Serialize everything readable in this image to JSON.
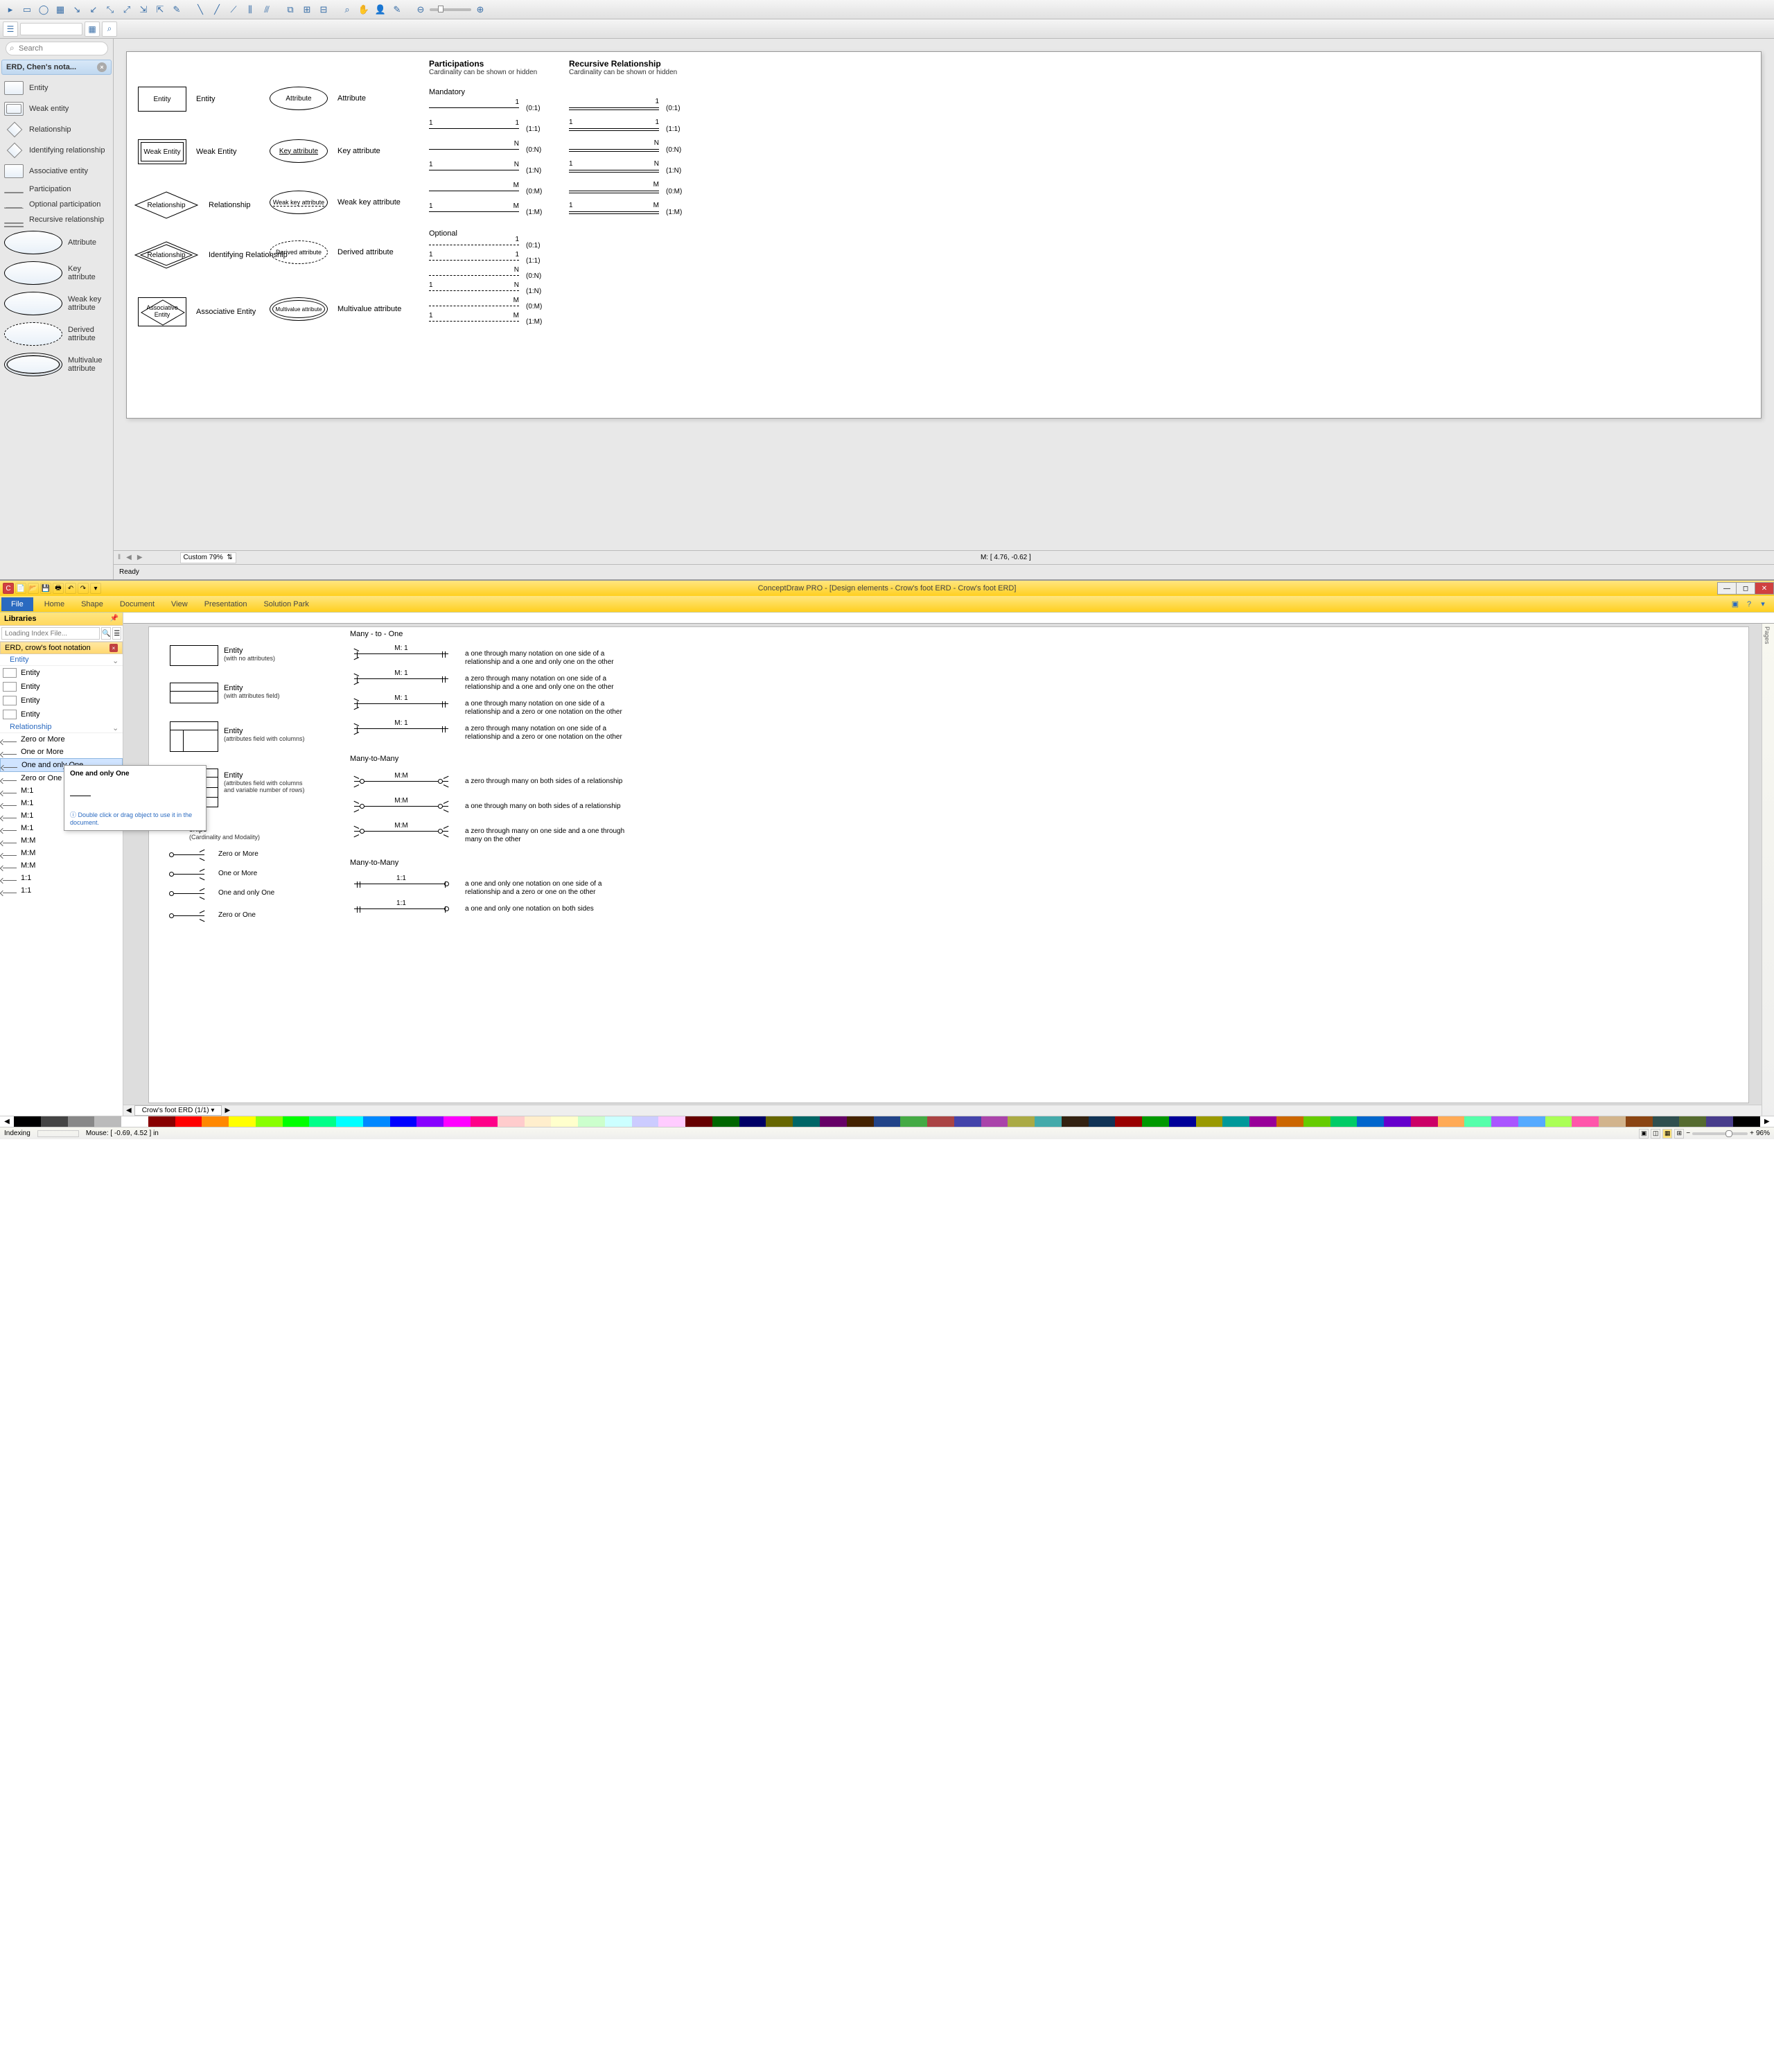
{
  "app1": {
    "search_placeholder": "Search",
    "sidebar_title": "ERD, Chen's nota...",
    "items": [
      {
        "label": "Entity"
      },
      {
        "label": "Weak entity"
      },
      {
        "label": "Relationship"
      },
      {
        "label": "Identifying relationship"
      },
      {
        "label": "Associative entity"
      },
      {
        "label": "Participation"
      },
      {
        "label": "Optional participation"
      },
      {
        "label": "Recursive relationship"
      },
      {
        "label": "Attribute"
      },
      {
        "label": "Key attribute"
      },
      {
        "label": "Weak key attribute"
      },
      {
        "label": "Derived attribute"
      },
      {
        "label": "Multivalue attribute"
      }
    ],
    "canvas": {
      "participations_title": "Participations",
      "participations_sub": "Cardinality can be shown or hidden",
      "recursive_title": "Recursive Relationship",
      "recursive_sub": "Cardinality can be shown or hidden",
      "mandatory": "Mandatory",
      "optional": "Optional",
      "shapes": {
        "entity": "Entity",
        "entity_lbl": "Entity",
        "weak_entity": "Weak Entity",
        "weak_entity_lbl": "Weak Entity",
        "relationship": "Relationship",
        "relationship_lbl": "Relationship",
        "id_relationship": "Relationship",
        "id_relationship_lbl": "Identifying Relationship",
        "assoc_entity": "Associative\nEntity",
        "assoc_entity_lbl": "Associative Entity",
        "attribute": "Attribute",
        "attribute_lbl": "Attribute",
        "key_attr": "Key attribute",
        "key_attr_lbl": "Key attribute",
        "weak_key_attr": "Weak key attribute",
        "weak_key_attr_lbl": "Weak key attribute",
        "derived_attr": "Derived attribute",
        "derived_attr_lbl": "Derived attribute",
        "multi_attr": "Multivalue attribute",
        "multi_attr_lbl": "Multivalue attribute"
      },
      "card": [
        {
          "l": "",
          "r": "1",
          "t": "(0:1)"
        },
        {
          "l": "1",
          "r": "1",
          "t": "(1:1)"
        },
        {
          "l": "",
          "r": "N",
          "t": "(0:N)"
        },
        {
          "l": "1",
          "r": "N",
          "t": "(1:N)"
        },
        {
          "l": "",
          "r": "M",
          "t": "(0:M)"
        },
        {
          "l": "1",
          "r": "M",
          "t": "(1:M)"
        }
      ],
      "opt_card": [
        {
          "l": "",
          "r": "1",
          "t": "(0:1)"
        },
        {
          "l": "1",
          "r": "1",
          "t": "(1:1)"
        },
        {
          "l": "",
          "r": "N",
          "t": "(0:N)"
        },
        {
          "l": "1",
          "r": "N",
          "t": "(1:N)"
        },
        {
          "l": "",
          "r": "M",
          "t": "(0:M)"
        },
        {
          "l": "1",
          "r": "M",
          "t": "(1:M)"
        }
      ]
    },
    "zoom": "Custom 79%",
    "coords": "M: [ 4.76, -0.62 ]",
    "status": "Ready"
  },
  "app2": {
    "title": "ConceptDraw PRO - [Design elements - Crow's foot ERD - Crow's foot ERD]",
    "menu": [
      "Home",
      "Shape",
      "Document",
      "View",
      "Presentation",
      "Solution Park"
    ],
    "file_label": "File",
    "libraries_label": "Libraries",
    "search_placeholder": "Loading Index File...",
    "lib_tag": "ERD, crow's foot notation",
    "groups": {
      "entity": "Entity",
      "relationship": "Relationship"
    },
    "entity_items": [
      "Entity",
      "Entity",
      "Entity",
      "Entity"
    ],
    "rel_items": [
      "Zero or More",
      "One or More",
      "One and only One",
      "Zero or One",
      "M:1",
      "M:1",
      "M:1",
      "M:1",
      "M:M",
      "M:M",
      "M:M",
      "1:1",
      "1:1"
    ],
    "tooltip": {
      "title": "One and only One",
      "note": "Double click or drag object to use it in the document."
    },
    "canvas": {
      "many_to_one": "Many - to - One",
      "many_to_many": "Many-to-Many",
      "many_to_many2": "Many-to-Many",
      "entities": [
        {
          "lbl": "Entity",
          "sub": "(with no attributes)"
        },
        {
          "lbl": "Entity",
          "sub": "(with attributes field)"
        },
        {
          "lbl": "Entity",
          "sub": "(attributes field with columns)"
        },
        {
          "lbl": "Entity",
          "sub": "(attributes field with columns and variable number of rows)"
        }
      ],
      "relationships_lbl": "ships",
      "relationships_sub": "(Cardinality and Modality)",
      "short_rels": [
        "Zero or More",
        "One or More",
        "One and only One",
        "Zero or One"
      ],
      "m1": [
        {
          "lbl": "M: 1",
          "desc": "a one through many notation on one side of a relationship and a one and only one on the other"
        },
        {
          "lbl": "M: 1",
          "desc": "a zero through many notation on one side of a relationship and a one and only one on the other"
        },
        {
          "lbl": "M: 1",
          "desc": "a one through many notation on one side of a relationship and a zero or one notation on the other"
        },
        {
          "lbl": "M: 1",
          "desc": "a zero through many notation on one side of a relationship and a zero or one notation on the other"
        }
      ],
      "mm": [
        {
          "lbl": "M:M",
          "desc": "a zero through many on both sides of a relationship"
        },
        {
          "lbl": "M:M",
          "desc": "a one through many on both sides of a relationship"
        },
        {
          "lbl": "M:M",
          "desc": "a zero through many on one side and a one through many on the other"
        }
      ],
      "oo": [
        {
          "lbl": "1:1",
          "desc": "a one and only one notation on one side of a relationship and a zero or one on the other"
        },
        {
          "lbl": "1:1",
          "desc": "a one and only one notation on both sides"
        }
      ]
    },
    "tab_name": "Crow's foot ERD (1/1)",
    "pages_label": "Pages",
    "status": {
      "indexing": "Indexing",
      "mouse": "Mouse: [ -0.69, 4.52 ] in",
      "zoom": "96%"
    },
    "palette": [
      "#000",
      "#444",
      "#888",
      "#bbb",
      "#fff",
      "#800",
      "#f00",
      "#f80",
      "#ff0",
      "#8f0",
      "#0f0",
      "#0f8",
      "#0ff",
      "#08f",
      "#00f",
      "#80f",
      "#f0f",
      "#f08",
      "#fcc",
      "#fec",
      "#ffc",
      "#cfc",
      "#cff",
      "#ccf",
      "#fcf",
      "#600",
      "#060",
      "#006",
      "#660",
      "#066",
      "#606",
      "#420",
      "#248",
      "#4a4",
      "#a44",
      "#44a",
      "#a4a",
      "#aa4",
      "#4aa",
      "#321",
      "#135",
      "#900",
      "#090",
      "#009",
      "#990",
      "#099",
      "#909",
      "#c60",
      "#6c0",
      "#0c6",
      "#06c",
      "#60c",
      "#c06",
      "#fa5",
      "#5fa",
      "#a5f",
      "#5af",
      "#af5",
      "#f5a",
      "#d2b48c",
      "#8b4513",
      "#2f4f4f",
      "#556b2f",
      "#483d8b",
      "#000"
    ]
  }
}
